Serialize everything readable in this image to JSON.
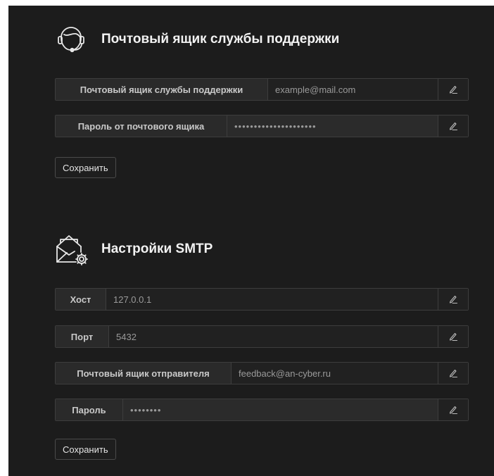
{
  "support": {
    "title": "Почтовый ящик службы поддержки",
    "icon": "headset-icon",
    "fields": [
      {
        "label": "Почтовый ящик службы поддержки",
        "value": "example@mail.com"
      },
      {
        "label": "Пароль от почтового ящика",
        "value": "•••••••••••••••••••••"
      }
    ],
    "save_label": "Сохранить"
  },
  "smtp": {
    "title": "Настройки SMTP",
    "icon": "mail-settings-icon",
    "fields": [
      {
        "label": "Хост",
        "value": "127.0.0.1"
      },
      {
        "label": "Порт",
        "value": "5432"
      },
      {
        "label": "Почтовый ящик отправителя",
        "value": "feedback@an-cyber.ru"
      },
      {
        "label": "Пароль",
        "value": "••••••••"
      }
    ],
    "save_label": "Сохранить"
  },
  "edit_icon": "pencil-icon",
  "colors": {
    "background": "#1c1c1c",
    "field_label_bg": "#2a2a2a",
    "border": "#3d3d3d",
    "title": "#f2f2f2"
  }
}
